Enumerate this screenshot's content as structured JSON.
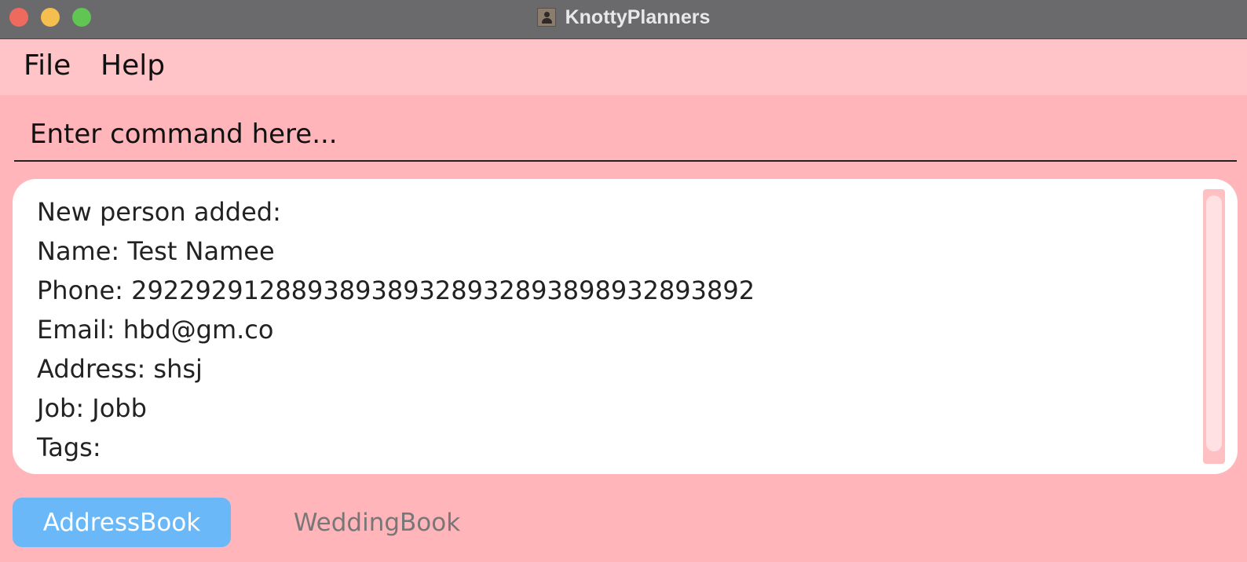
{
  "window": {
    "title": "KnottyPlanners"
  },
  "menu": {
    "items": [
      "File",
      "Help"
    ]
  },
  "command": {
    "placeholder": "Enter command here..."
  },
  "result": {
    "lines": [
      "New person added:",
      "Name: Test Namee",
      "Phone: 292292912889389389328932893898932893892",
      "Email: hbd@gm.co",
      "Address: shsj",
      "Job: Jobb",
      "Tags:"
    ]
  },
  "tabs": [
    {
      "label": "AddressBook",
      "selected": true
    },
    {
      "label": "WeddingBook",
      "selected": false
    }
  ],
  "colors": {
    "background": "#ffb5ba",
    "menubar": "#ffc4c8",
    "selected_tab": "#6ab8f7",
    "titlebar": "#6a6a6c"
  }
}
